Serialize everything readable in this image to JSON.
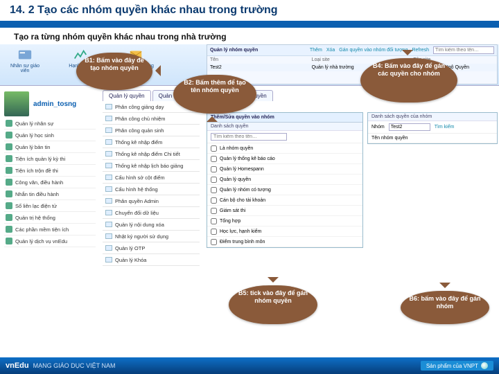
{
  "header": {
    "title": "14. 2 Tạo các nhóm quyền khác nhau trong trường"
  },
  "subtitle": "Tạo ra từng nhóm quyền khác nhau trong nhà trường",
  "ribbon": [
    {
      "label": "Nhân sự giáo viên"
    },
    {
      "label": "Hạnh kiểm"
    },
    {
      "label": "Tin nhắn thương hiệu"
    }
  ],
  "user": "admin_tosng",
  "sidebar": [
    "Quản lý nhân sự",
    "Quản lý học sinh",
    "Quản lý bản tin",
    "Tiện ích quản lý kỳ thi",
    "Tiện ích trộn đề thi",
    "Công văn, điều hành",
    "Nhắn tin điều hành",
    "Sổ liên lạc điện tử",
    "Quản trị hệ thống",
    "Các phần mềm tiện ích",
    "Quản lý dịch vụ vnEdu"
  ],
  "tabs": [
    "Quản lý quyền",
    "Quản lý tài khoản",
    "Quản lý nhóm quyền"
  ],
  "col2": [
    "Phân công giảng dạy",
    "Phân công chủ nhiệm",
    "Phân công quản sinh",
    "Thống kê nhập điểm",
    "Thống kê nhập điểm Chi tiết",
    "Thống kê nhập lịch báo giảng",
    "Cấu hình sở cột điểm",
    "Cấu hình hệ thống",
    "Phân quyền Admin",
    "Chuyển đổi dữ liệu",
    "Quản lý nội dung xóa",
    "Nhật ký người sử dụng",
    "Quản lý OTP",
    "Quản lý Khóa"
  ],
  "toppanel": {
    "title": "Quản lý nhóm quyền",
    "btns": [
      "Thêm",
      "Xóa",
      "Gán quyền vào nhóm đối tượng",
      "Refresh"
    ],
    "search": "Tìm kiếm theo tên…",
    "cols": [
      "Tên",
      "Loại site",
      "Tên site"
    ],
    "row": [
      "Test2",
      "Quản lý nhà trường",
      "Trường THPT Ngô Quyền"
    ]
  },
  "dialog": {
    "title": "Thêm/Sửa quyền vào nhóm",
    "sub": "Danh sách quyền",
    "search": "Tìm kiếm theo tên…",
    "items": [
      "Là nhóm quyền",
      "Quản lý thống kê báo cáo",
      "Quản lý Homespann",
      "Quản lý quyền",
      "Quản lý nhóm có tượng",
      "Cán bộ cho tài khoản",
      "Giám sát thi",
      "Tổng hợp",
      "Học lực, hạnh kiểm",
      "Điểm trung bình môn"
    ]
  },
  "rpanel": {
    "sub": "Danh sách quyền của nhóm",
    "nhom": "Nhóm",
    "nhomval": "Test2",
    "btn": "Tìm kiếm",
    "label": "Tên nhóm quyền"
  },
  "bubbles": {
    "b1": "B1: Bấm vào đây để tạo nhóm quyền",
    "b2": "B2: Bấm thêm để tạo tên nhóm quyền",
    "b4": "B4: Bấm vào đây để gán các quyền cho nhóm",
    "b5": "B5: tick vào đây để gán nhóm quyền",
    "b6": "B6: bấm vào đây để gán nhóm"
  },
  "footer": {
    "brand": "vnEdu",
    "tag": "MẠNG GIÁO DỤC VIỆT NAM",
    "right": "Sản phẩm của VNPT"
  }
}
